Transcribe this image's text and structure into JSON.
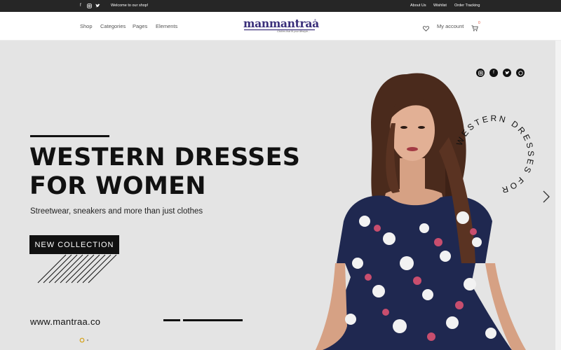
{
  "topbar": {
    "social": [
      "facebook-icon",
      "instagram-icon",
      "twitter-icon"
    ],
    "welcome": "Welcome to our shop!",
    "links": [
      "About Us",
      "Wishlist",
      "Order Tracking"
    ]
  },
  "header": {
    "nav": [
      "Shop",
      "Categories",
      "Pages",
      "Elements"
    ],
    "logo_text": "manmantraa",
    "logo_tagline": "Clothes that fit your lifestyle...",
    "account": "My account",
    "cart_count": "0"
  },
  "hero": {
    "title_line1": "WESTERN DRESSES",
    "title_line2": "FOR WOMEN",
    "subtitle": "Streetwear, sneakers and more than just clothes",
    "button": "NEW COLLECTION",
    "website": "www.mantraa.co",
    "circular_text": "WESTERN DRESSES FOR",
    "social_icons": [
      "instagram-icon",
      "facebook-icon",
      "twitter-icon",
      "whatsapp-icon"
    ],
    "next_arrow": "chevron-right-icon"
  },
  "colors": {
    "dark": "#111111",
    "topbar": "#262626",
    "brand": "#3a2f7a",
    "accent": "#e0523a",
    "dot_active": "#d4a017"
  }
}
